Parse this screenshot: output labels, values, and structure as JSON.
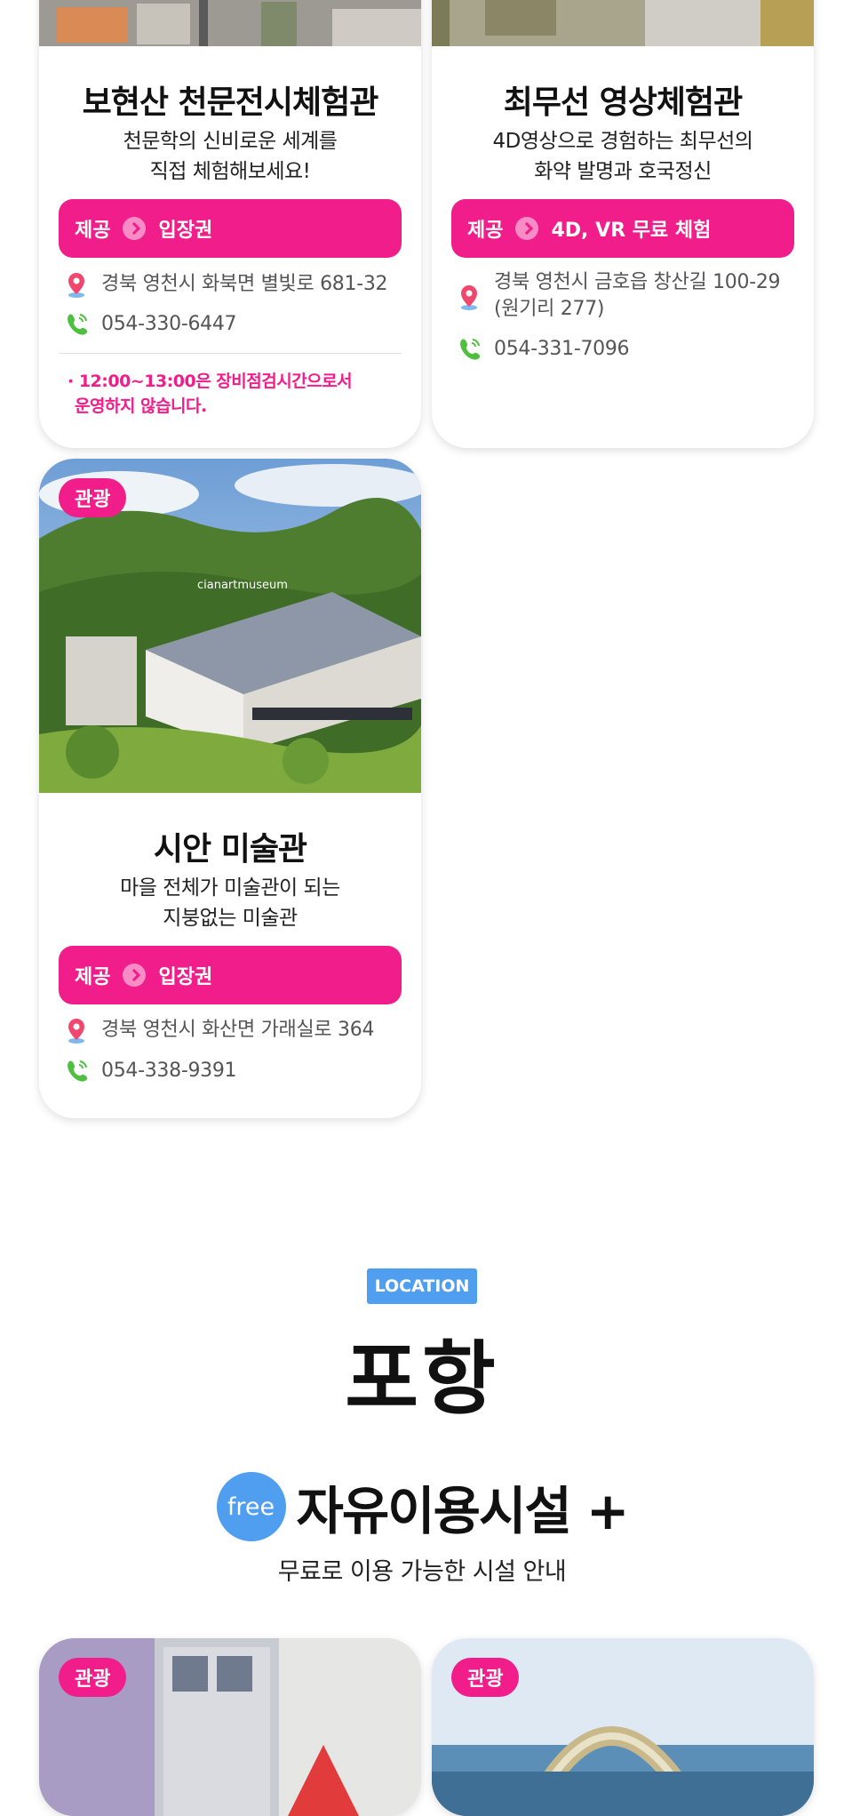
{
  "cards": [
    {
      "title": "보현산 천문전시체험관",
      "desc_lines": [
        "천문학의 신비로운 세계를",
        "직접 체험해보세요!"
      ],
      "provide_label": "제공",
      "provide_value": "입장권",
      "address": "경북 영천시 화북면 별빛로 681-32",
      "phone": "054-330-6447",
      "note_lines": [
        "· 12:00~13:00은 장비점검시간으로서",
        "운영하지 않습니다."
      ]
    },
    {
      "title": "최무선 영상체험관",
      "desc_lines": [
        "4D영상으로 경험하는 최무선의",
        "화약 발명과 호국정신"
      ],
      "provide_label": "제공",
      "provide_value": "4D, VR 무료 체험",
      "address_lines": [
        "경북 영천시 금호읍 창산길 100-29",
        "(원기리 277)"
      ],
      "phone": "054-331-7096"
    },
    {
      "tag": "관광",
      "museum_sign": "cianartmuseum",
      "title": "시안 미술관",
      "desc_lines": [
        "마을 전체가 미술관이 되는",
        "지붕없는 미술관"
      ],
      "provide_label": "제공",
      "provide_value": "입장권",
      "address": "경북 영천시 화산면 가래실로 364",
      "phone": "054-338-9391"
    }
  ],
  "location": {
    "badge": "LOCATION",
    "region": "포항"
  },
  "free_section": {
    "circle": "free",
    "title": "자유이용시설 +",
    "subtitle": "무료로 이용 가능한 시설 안내"
  },
  "bottom_cards": [
    {
      "tag": "관광"
    },
    {
      "tag": "관광"
    }
  ],
  "colors": {
    "accent_pink": "#f01d8a",
    "accent_blue": "#4f9ef0"
  },
  "icons": {
    "address": "map-pin-icon",
    "phone": "phone-icon",
    "provide": "chevron-right-icon"
  }
}
